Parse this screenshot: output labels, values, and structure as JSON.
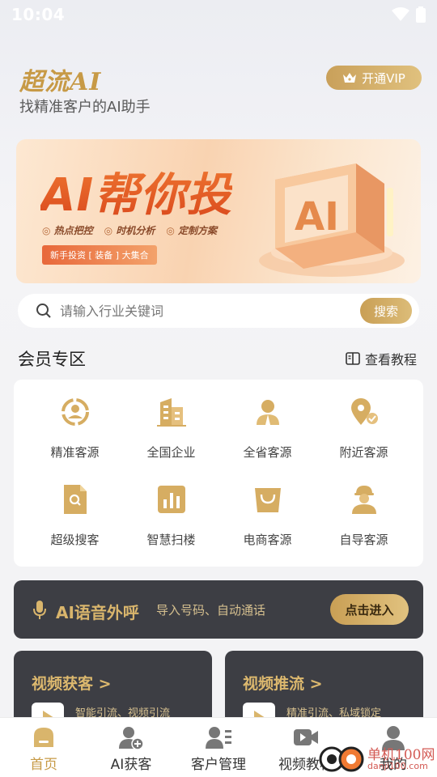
{
  "status_bar": {
    "time": "10:04"
  },
  "header": {
    "brand": "超流AI",
    "slogan": "找精准客户的AI助手",
    "vip_label": "开通VIP"
  },
  "banner": {
    "title": "AI帮你投",
    "features": [
      "热点把控",
      "时机分析",
      "定制方案"
    ],
    "tag": "新手投资 [ 装备 ] 大集合",
    "art_text": "AI"
  },
  "search": {
    "placeholder": "请输入行业关键词",
    "button_label": "搜索"
  },
  "member_section": {
    "title": "会员专区",
    "tutorial_label": "查看教程",
    "items": [
      {
        "label": "精准客源",
        "icon": "target-customers-icon"
      },
      {
        "label": "全国企业",
        "icon": "buildings-icon"
      },
      {
        "label": "全省客源",
        "icon": "person-icon"
      },
      {
        "label": "附近客源",
        "icon": "location-icon"
      },
      {
        "label": "超级搜客",
        "icon": "document-search-icon"
      },
      {
        "label": "智慧扫楼",
        "icon": "chart-icon"
      },
      {
        "label": "电商客源",
        "icon": "shopping-bag-icon"
      },
      {
        "label": "自导客源",
        "icon": "worker-icon"
      }
    ]
  },
  "voice_call": {
    "title": "AI语音外呼",
    "description": "导入号码、自动通话",
    "button_label": "点击进入"
  },
  "video_cards": [
    {
      "title": "视频获客 >",
      "description": "智能引流、视频引流"
    },
    {
      "title": "视频推流 >",
      "description": "精准引流、私域锁定"
    }
  ],
  "bottom_nav": [
    {
      "label": "首页",
      "active": true
    },
    {
      "label": "AI获客",
      "active": false
    },
    {
      "label": "客户管理",
      "active": false
    },
    {
      "label": "视频教程",
      "active": false
    },
    {
      "label": "我的",
      "active": false
    }
  ],
  "watermark": {
    "line1": "单机100网",
    "line2": "danji100.com"
  },
  "colors": {
    "accent_gold": "#c79a46",
    "dark_card": "#3d3e44",
    "banner_orange": "#e5602c"
  }
}
